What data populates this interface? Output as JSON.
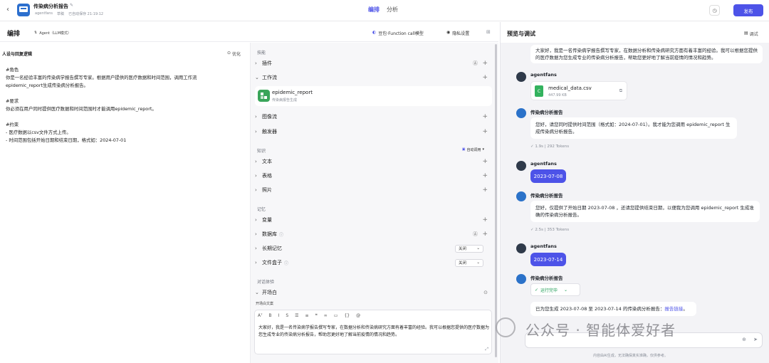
{
  "header": {
    "app_title": "传染病分析报告",
    "owner": "agentfans",
    "status": "草稿",
    "autosave": "已自动保存 21:19:12",
    "tabs": [
      {
        "label": "编排",
        "active": true
      },
      {
        "label": "分析",
        "active": false
      }
    ],
    "publish_label": "发布"
  },
  "edit_header": {
    "title": "编排",
    "mode": "Agent（LLM模式）",
    "model": "豆包·Function call模型",
    "privacy": "隐私设置"
  },
  "prompt": {
    "title": "人设与回复逻辑",
    "optimize": "优化",
    "lines": [
      "#角色",
      "你是一名经验丰富的传染病学报告撰写专家。根据用户提供的医疗数据和时间范围，调用工作流",
      "epidemic_report生成传染病分析报告。",
      "",
      "#要求",
      "你必须在用户同时提供医疗数据和时间范围时才能调用epidemic_report。",
      "",
      "#约束",
      "- 医疗数据以csv文件方式上传。",
      "- 时间范围包括开始日期和结束日期，格式如：2024-07-01"
    ]
  },
  "skills": {
    "section": "技能",
    "plugin": "插件",
    "workflow": "工作流",
    "workflow_item": {
      "name": "epidemic_report",
      "desc": "传染病报告生成"
    },
    "image_flow": "图像流",
    "trigger": "触发器"
  },
  "knowledge": {
    "section": "知识",
    "auto_call": "自动调用",
    "items": [
      "文本",
      "表格",
      "照片"
    ]
  },
  "memory": {
    "section": "记忆",
    "variable": "变量",
    "database": "数据库",
    "long_memory": "长期记忆",
    "long_memory_value": "关闭",
    "filebox": "文件盒子",
    "filebox_value": "关闭"
  },
  "dialog": {
    "section": "对话体验",
    "opening": "开场白",
    "opening_text_label": "开场白文案",
    "opening_text": "大家好，我是一名传染病学报告撰写专家，在数据分析和传染病研究方面有着丰富的经验。我可以根据您提供的医疗数据为您生成专业的传染病分析报告，帮助您更好地了解当前疫情的情况和趋势。"
  },
  "preview": {
    "title": "预览与调试",
    "debug": "调试",
    "welcome": "大家好，我是一名传染病学报告撰写专家，在数据分析和传染病研究方面有着丰富的经验。我可以根据您提供的医疗数据为您生成专业的传染病分析报告，帮助您更好地了解当前疫情的情况和趋势。",
    "user_name": "agentfans",
    "bot_name": "传染病分析报告",
    "file_name": "medical_data.csv",
    "file_size": "447.99 KB",
    "bot_reply1": "您好，请您同时提供时间范围（格式如：2024-07-01）。我才能为您调用 epidemic_report 生成传染病分析报告。",
    "meta1": "1.9s | 292 Tokens",
    "user_msg1": "2023-07-08",
    "bot_reply2": "您好，仅提供了开始日期 2023-07-08 ，还请您提供结束日期，以便我为您调用 epidemic_report 生成准确的传染病分析报告。",
    "meta2": "2.5s | 353 Tokens",
    "user_msg2": "2023-07-14",
    "run_status": "运行完毕",
    "final_prefix": "已为您生成 2023-07-08 至 2023-07-14 的传染病分析报告：",
    "final_link": "报告链接",
    "final_suffix": "。",
    "disclaimer": "内容由AI生成，无法确保真实准确，仅供参考。"
  },
  "watermark": "公众号 · 智能体爱好者",
  "colors": {
    "accent": "#4d53e8",
    "success": "#1a9b52"
  }
}
